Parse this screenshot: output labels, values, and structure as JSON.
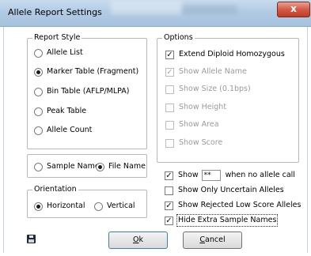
{
  "window": {
    "title": "Allele Report Settings",
    "close_glyph": "x"
  },
  "report_style": {
    "legend": "Report Style",
    "options": [
      {
        "label": "Allele List",
        "selected": false
      },
      {
        "label": "Marker Table (Fragment)",
        "selected": true
      },
      {
        "label": "Bin Table (AFLP/MLPA)",
        "selected": false
      },
      {
        "label": "Peak Table",
        "selected": false
      },
      {
        "label": "Allele Count",
        "selected": false
      }
    ]
  },
  "name_choice": {
    "options": [
      {
        "label": "Sample Name",
        "selected": false
      },
      {
        "label": "File Name",
        "selected": true
      }
    ]
  },
  "orientation": {
    "legend": "Orientation",
    "options": [
      {
        "label": "Horizontal",
        "selected": true
      },
      {
        "label": "Vertical",
        "selected": false
      }
    ]
  },
  "options": {
    "legend": "Options",
    "items": [
      {
        "label": "Extend Diploid Homozygous",
        "checked": true,
        "enabled": true
      },
      {
        "label": "Show Allele Name",
        "checked": true,
        "enabled": false
      },
      {
        "label": "Show Size (0.1bps)",
        "checked": false,
        "enabled": false
      },
      {
        "label": "Show Height",
        "checked": false,
        "enabled": false
      },
      {
        "label": "Show Area",
        "checked": false,
        "enabled": false
      },
      {
        "label": "Show Score",
        "checked": false,
        "enabled": false
      }
    ]
  },
  "extra": {
    "show_label": "Show",
    "show_value": "**",
    "show_suffix": "when no allele call",
    "items": [
      {
        "label": "Show Only Uncertain Alleles",
        "checked": false
      },
      {
        "label": "Show Rejected Low Score Alleles",
        "checked": true
      },
      {
        "label": "Hide Extra Sample Names",
        "checked": true
      }
    ]
  },
  "buttons": {
    "ok_access": "O",
    "ok_rest": "k",
    "cancel_access": "C",
    "cancel_rest": "ancel"
  },
  "icons": {
    "save": "floppy-disk-icon"
  },
  "colors": {
    "close_button": "#d45a44",
    "title_bar": "#b2cbe4"
  }
}
